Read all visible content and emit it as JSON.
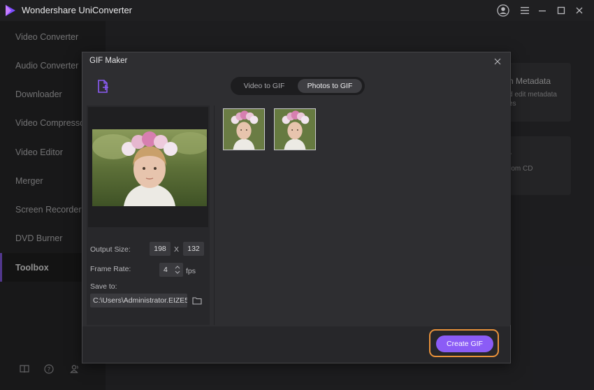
{
  "app": {
    "title": "Wondershare UniConverter",
    "accent": "#8b5cf6"
  },
  "sidebar": {
    "items": [
      {
        "label": "Video Converter"
      },
      {
        "label": "Audio Converter"
      },
      {
        "label": "Downloader"
      },
      {
        "label": "Video Compressor"
      },
      {
        "label": "Video Editor"
      },
      {
        "label": "Merger"
      },
      {
        "label": "Screen Recorder"
      },
      {
        "label": "DVD Burner"
      },
      {
        "label": "Toolbox",
        "active": true
      }
    ]
  },
  "background_cards": [
    {
      "title": "n Metadata",
      "line1": "d edit metadata",
      "line2": "es"
    },
    {
      "title": "r",
      "line1": "rom CD"
    }
  ],
  "modal": {
    "title": "GIF Maker",
    "tabs": [
      {
        "label": "Video to GIF",
        "active": false
      },
      {
        "label": "Photos to GIF",
        "active": true
      }
    ],
    "settings": {
      "output_size_label": "Output Size:",
      "width": "198",
      "x_sep": "X",
      "height": "132",
      "frame_rate_label": "Frame Rate:",
      "frame_rate": "4",
      "fps_unit": "fps",
      "save_to_label": "Save to:",
      "save_path": "C:\\Users\\Administrator.EIZE5"
    },
    "photos_count": 2,
    "create_button": "Create GIF",
    "highlight_color": "#e8913a"
  }
}
